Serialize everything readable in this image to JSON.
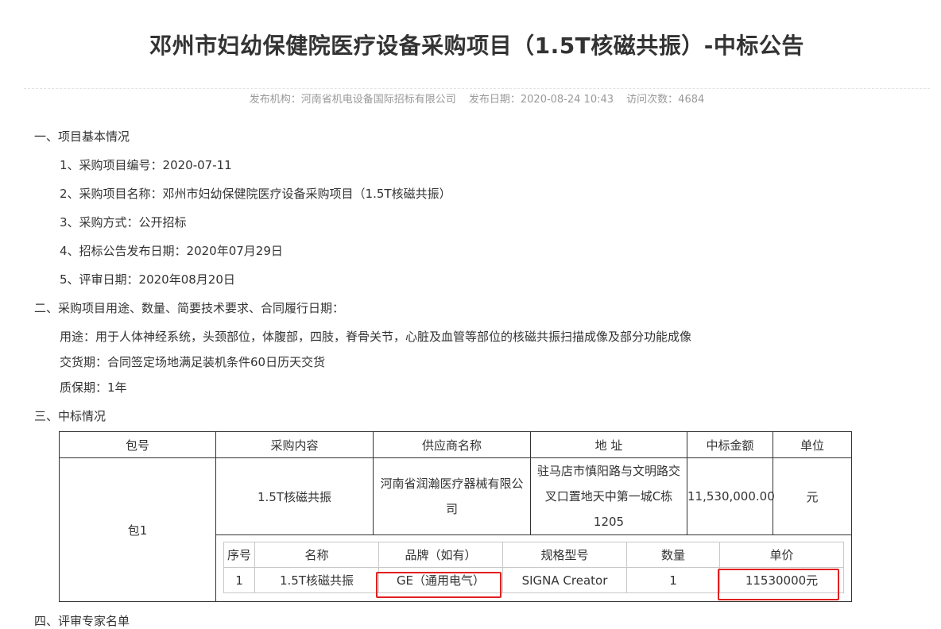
{
  "header": {
    "title": "邓州市妇幼保健院医疗设备采购项目（1.5T核磁共振）-中标公告",
    "publisher": "发布机构：河南省机电设备国际招标有限公司",
    "publish_date": "发布日期：2020-08-24 10:43",
    "visits": "访问次数：4684"
  },
  "section1": {
    "heading": "一、项目基本情况",
    "items": [
      "1、采购项目编号：2020-07-11",
      "2、采购项目名称：邓州市妇幼保健院医疗设备采购项目（1.5T核磁共振）",
      "3、采购方式：公开招标",
      "4、招标公告发布日期：2020年07月29日",
      "5、评审日期：2020年08月20日"
    ]
  },
  "section2": {
    "heading": "二、采购项目用途、数量、简要技术要求、合同履行日期：",
    "usage": "用途：用于人体神经系统，头颈部位，体腹部，四肢，脊骨关节，心脏及血管等部位的核磁共振扫描成像及部分功能成像",
    "delivery": "交货期：合同签定场地满足装机条件60日历天交货",
    "warranty": "质保期：1年"
  },
  "section3": {
    "heading": "三、中标情况",
    "table": {
      "headers": [
        "包号",
        "采购内容",
        "供应商名称",
        "地 址",
        "中标金额",
        "单位"
      ],
      "row": {
        "package": "包1",
        "content": "1.5T核磁共振",
        "supplier": "河南省润瀚医疗器械有限公司",
        "address": "驻马店市慎阳路与文明路交叉口置地天中第一城C栋1205",
        "amount": "11,530,000.00",
        "unit": "元"
      },
      "sub_headers": [
        "序号",
        "名称",
        "品牌（如有）",
        "规格型号",
        "数量",
        "单价"
      ],
      "sub_row": {
        "index": "1",
        "name": "1.5T核磁共振",
        "brand": "GE（通用电气）",
        "model": "SIGNA Creator",
        "quantity": "1",
        "unit_price": "11530000元"
      }
    }
  },
  "section4": {
    "heading": "四、评审专家名单"
  },
  "colors": {
    "text": "#333333",
    "meta": "#999999",
    "highlight_box": "#e02020"
  }
}
